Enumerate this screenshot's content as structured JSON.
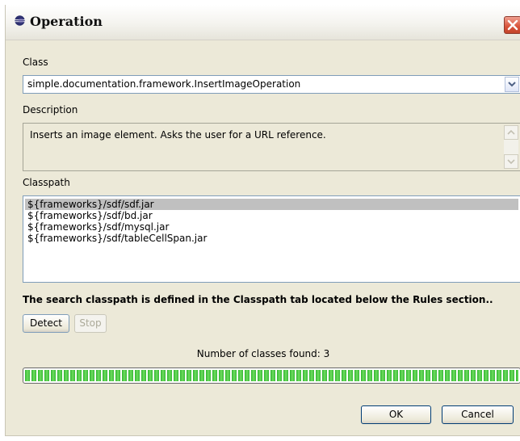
{
  "window": {
    "title": "Operation"
  },
  "class_section": {
    "label": "Class",
    "selected_value": "simple.documentation.framework.InsertImageOperation"
  },
  "description_section": {
    "label": "Description",
    "text": "Inserts an image element. Asks the user for a URL reference."
  },
  "classpath_section": {
    "label": "Classpath",
    "entries": [
      "${frameworks}/sdf/sdf.jar",
      "${frameworks}/sdf/bd.jar",
      "${frameworks}/sdf/mysql.jar",
      "${frameworks}/sdf/tableCellSpan.jar"
    ],
    "selected_index": 0,
    "note": "The search classpath is defined in the Classpath tab located below the Rules section.."
  },
  "detect": {
    "detect_label": "Detect",
    "stop_label": "Stop",
    "found_text": "Number of classes found: 3",
    "progress_percent": 100
  },
  "buttons": {
    "ok_label": "OK",
    "cancel_label": "Cancel"
  },
  "icons": {
    "title": "eclipse-icon",
    "close": "close-icon",
    "combo_arrow": "chevron-down-icon",
    "scroll_up": "chevron-up-icon",
    "scroll_down": "chevron-down-icon"
  },
  "colors": {
    "progress": "#2fb52f",
    "close_button": "#d8533a",
    "selection": "#c0c0c0"
  }
}
